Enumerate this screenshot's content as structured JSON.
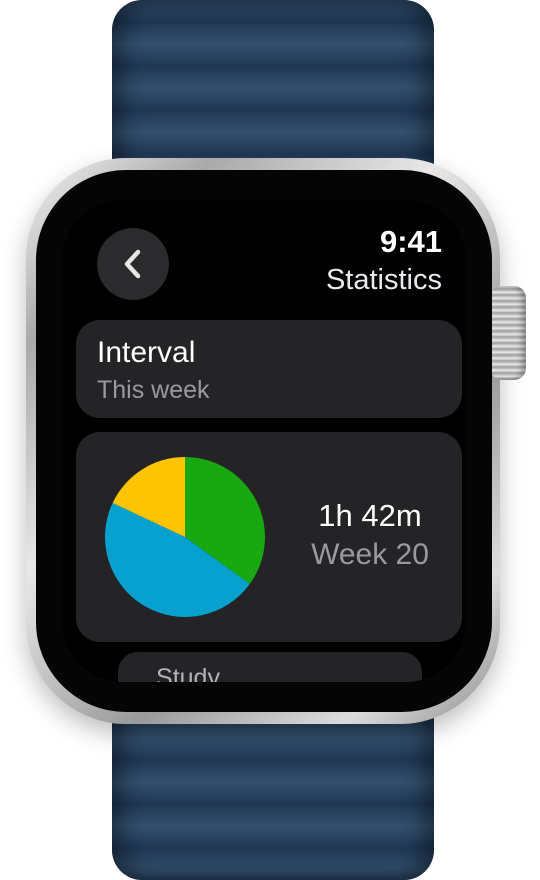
{
  "status": {
    "time": "9:41"
  },
  "header": {
    "title": "Statistics",
    "back_icon": "chevron-left-icon"
  },
  "interval": {
    "label": "Interval",
    "value": "This week"
  },
  "summary": {
    "duration": "1h 42m",
    "period": "Week 20"
  },
  "next_item": {
    "label": "Study"
  },
  "colors": {
    "screen_bg": "#000000",
    "card_bg": "#242426",
    "secondary_text": "#9a9a9e",
    "slice_green": "#17a90f",
    "slice_blue": "#06a1cf",
    "slice_yellow": "#fec400"
  },
  "chart_data": {
    "type": "pie",
    "slices": [
      {
        "value": 35,
        "color": "#17a90f"
      },
      {
        "value": 47,
        "color": "#06a1cf"
      },
      {
        "value": 18,
        "color": "#fec400"
      }
    ]
  }
}
